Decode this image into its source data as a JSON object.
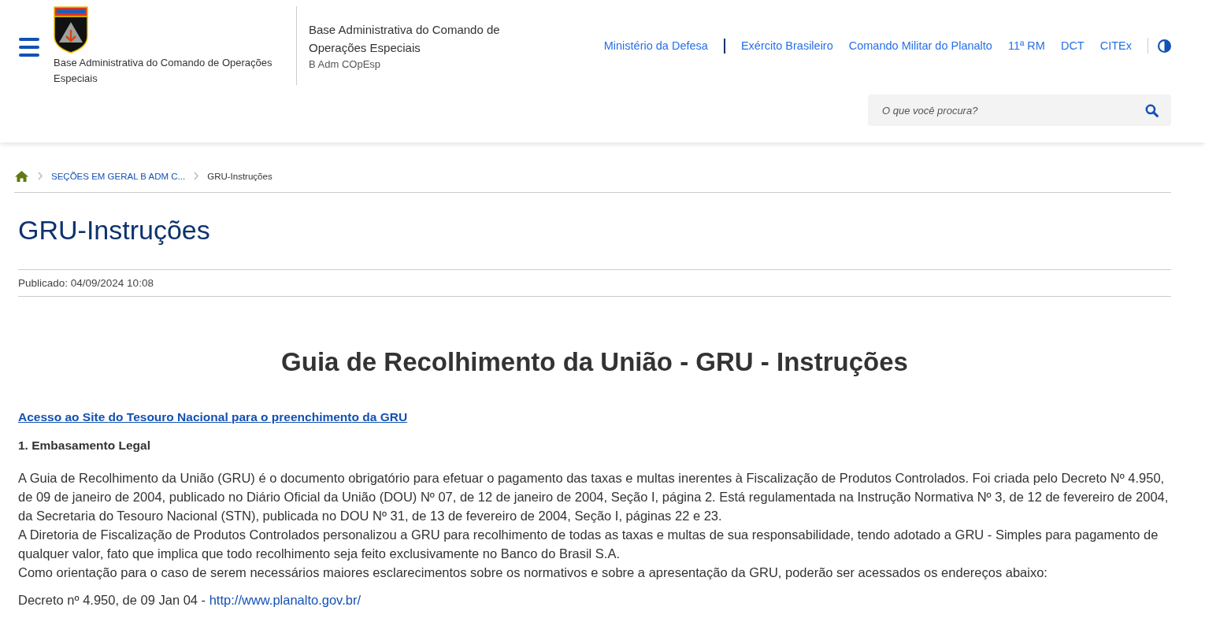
{
  "header": {
    "logo_caption": "Base Administrativa do Comando de Operações Especiais",
    "site_title": "Base Administrativa do Comando de Operações Especiais",
    "site_subtitle": "B Adm COpEsp",
    "links": [
      {
        "label": "Ministério da Defesa",
        "divider_after": true
      },
      {
        "label": "Exército Brasileiro",
        "divider_after": false
      },
      {
        "label": "Comando Militar do Planalto",
        "divider_after": false
      },
      {
        "label": "11ª RM",
        "divider_after": false
      },
      {
        "label": "DCT",
        "divider_after": false
      },
      {
        "label": "CITEx",
        "divider_after": false
      }
    ],
    "search": {
      "placeholder": "O que você procura?"
    }
  },
  "breadcrumb": [
    {
      "label": "SEÇÕES EM GERAL B ADM C...",
      "kind": "link"
    },
    {
      "label": "GRU-Instruções",
      "kind": "current"
    }
  ],
  "page_title": "GRU-Instruções",
  "published": "Publicado: 04/09/2024 10:08",
  "article": {
    "heading": "Guia de Recolhimento da União - GRU - Instruções",
    "top_link": "Acesso ao Site do Tesouro Nacional para o preenchimento da GRU",
    "section_heading": "1. Embasamento Legal",
    "paragraphs": [
      "A Guia de Recolhimento da União (GRU) é o documento obrigatório para efetuar o pagamento das taxas e multas inerentes à Fiscalização de Produtos Controlados. Foi criada pelo Decreto Nº 4.950, de 09 de janeiro de 2004, publicado no Diário Oficial da União (DOU) Nº 07, de 12 de janeiro de 2004, Seção I, página 2. Está regulamentada na Instrução Normativa Nº 3, de 12 de fevereiro de 2004, da Secretaria do Tesouro Nacional (STN), publicada no DOU Nº 31, de 13 de fevereiro de 2004, Seção I, páginas 22 e 23.",
      "A Diretoria de Fiscalização de Produtos Controlados personalizou a GRU para recolhimento de todas as taxas e multas de sua responsabilidade, tendo adotado a GRU - Simples para pagamento de qualquer valor, fato que implica que todo recolhimento seja feito exclusivamente no Banco do Brasil S.A.",
      "Como orientação para o caso de serem necessários maiores esclarecimentos sobre os normativos e sobre a apresentação da GRU, poderão ser acessados os endereços abaixo:"
    ],
    "reference": {
      "text": "Decreto nº 4.950, de 09 Jan 04 - ",
      "link": "http://www.planalto.gov.br/"
    }
  }
}
